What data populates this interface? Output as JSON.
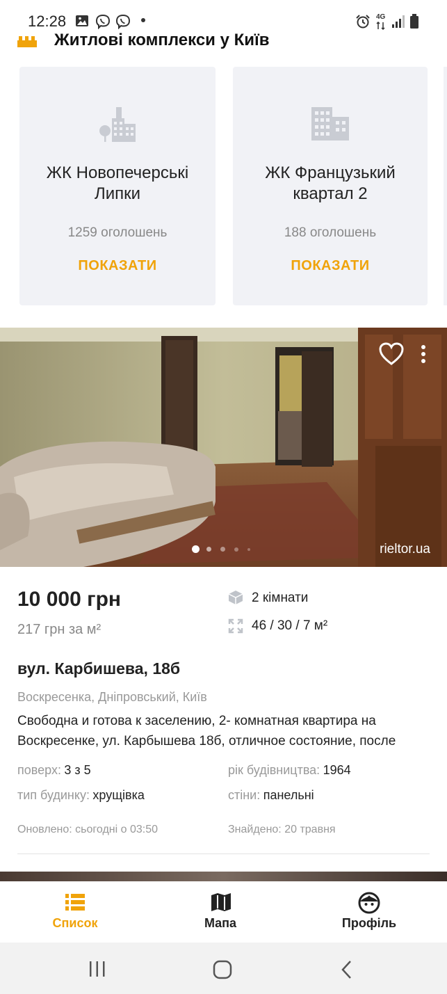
{
  "status_bar": {
    "time": "12:28",
    "network": "4G"
  },
  "section": {
    "title": "Житлові комплекси у Київ"
  },
  "complexes": [
    {
      "name_line1": "ЖК Новопечерські",
      "name_line2": "Липки",
      "count": "1259 оголошень",
      "button": "ПОКАЗАТИ",
      "icon": "buildings-tree-icon"
    },
    {
      "name_line1": "ЖК Французький",
      "name_line2": "квартал 2",
      "count": "188 оголошень",
      "button": "ПОКАЗАТИ",
      "icon": "building-icon"
    }
  ],
  "listing": {
    "source_watermark": "rieltor.ua",
    "gallery": {
      "current": 1,
      "total": 5
    },
    "price": "10 000 грн",
    "price_per_m2": "217 грн за м²",
    "rooms": "2 кімнати",
    "area": "46 / 30 / 7 м²",
    "address": "вул. Карбишева, 18б",
    "district": "Воскресенка, Дніпровський, Київ",
    "description": "Свободна и готова к заселению, 2- комнатная квартира на Воскресенке, ул. Карбышева 18б, отличное состояние, после",
    "floor_label": "поверх:",
    "floor_value": "3 з 5",
    "year_label": "рік будівництва:",
    "year_value": "1964",
    "type_label": "тип будинку:",
    "type_value": "хрущівка",
    "walls_label": "стіни:",
    "walls_value": "панельні",
    "updated": "Оновлено: сьогодні о 03:50",
    "found": "Знайдено: 20 травня"
  },
  "bottom_nav": [
    {
      "label": "Список",
      "icon": "list-icon",
      "active": true
    },
    {
      "label": "Мапа",
      "icon": "map-icon",
      "active": false
    },
    {
      "label": "Профіль",
      "icon": "profile-icon",
      "active": false
    }
  ],
  "colors": {
    "accent": "#f0a30a",
    "card_bg": "#f1f2f6",
    "muted": "#999999"
  }
}
